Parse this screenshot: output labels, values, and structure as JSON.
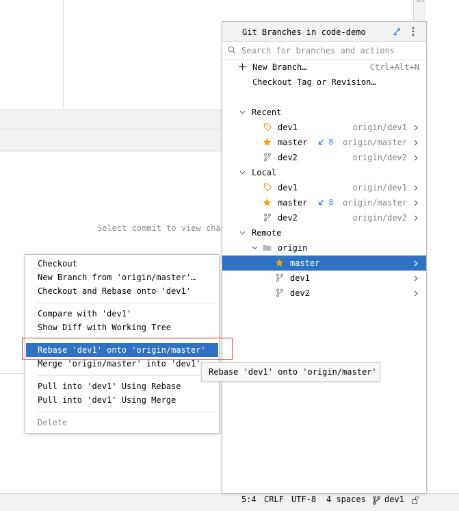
{
  "background": {
    "placeholder_text": "Select commit to view chan",
    "corner_text": "45"
  },
  "popup": {
    "title": "Git Branches in code-demo",
    "search_placeholder": "Search for branches and actions",
    "actions": [
      {
        "label": "New Branch…",
        "shortcut": "Ctrl+Alt+N"
      },
      {
        "label": "Checkout Tag or Revision…"
      }
    ],
    "groups": {
      "recent": {
        "label": "Recent",
        "items": [
          {
            "name": "dev1",
            "icon": "tag-icon",
            "tracking": "origin/dev1"
          },
          {
            "name": "master",
            "icon": "star-icon",
            "incoming": "8",
            "tracking": "origin/master"
          },
          {
            "name": "dev2",
            "icon": "branch-icon",
            "tracking": "origin/dev2"
          }
        ]
      },
      "local": {
        "label": "Local",
        "items": [
          {
            "name": "dev1",
            "icon": "tag-icon",
            "tracking": "origin/dev1"
          },
          {
            "name": "master",
            "icon": "star-icon",
            "incoming": "8",
            "tracking": "origin/master"
          },
          {
            "name": "dev2",
            "icon": "branch-icon",
            "tracking": "origin/dev2"
          }
        ]
      },
      "remote": {
        "label": "Remote",
        "folder": "origin",
        "items": [
          {
            "name": "master",
            "icon": "star-icon",
            "selected": true
          },
          {
            "name": "dev1",
            "icon": "branch-icon"
          },
          {
            "name": "dev2",
            "icon": "branch-icon"
          }
        ]
      }
    }
  },
  "context_menu": {
    "items": [
      {
        "label": "Checkout"
      },
      {
        "label": "New Branch from 'origin/master'…"
      },
      {
        "label": "Checkout and Rebase onto 'dev1'"
      },
      {
        "label": "Compare with 'dev1'"
      },
      {
        "label": "Show Diff with Working Tree"
      },
      {
        "label": "Rebase 'dev1' onto 'origin/master'",
        "highlighted": true
      },
      {
        "label": "Merge 'origin/master' into 'dev1'"
      },
      {
        "label": "Pull into 'dev1' Using Rebase"
      },
      {
        "label": "Pull into 'dev1' Using Merge"
      },
      {
        "label": "Delete",
        "disabled": true
      }
    ]
  },
  "tooltip": {
    "text": "Rebase 'dev1' onto 'origin/master'"
  },
  "status_bar": {
    "position": "5:4",
    "line_separator": "CRLF",
    "encoding": "UTF-8",
    "indent": "4 spaces",
    "branch": "dev1"
  },
  "colors": {
    "selection": "#2f72c4",
    "accent_blue": "#3574f0",
    "star": "#f0a30a",
    "tag": "#e8a33c",
    "annotation_red": "#e0443e"
  }
}
